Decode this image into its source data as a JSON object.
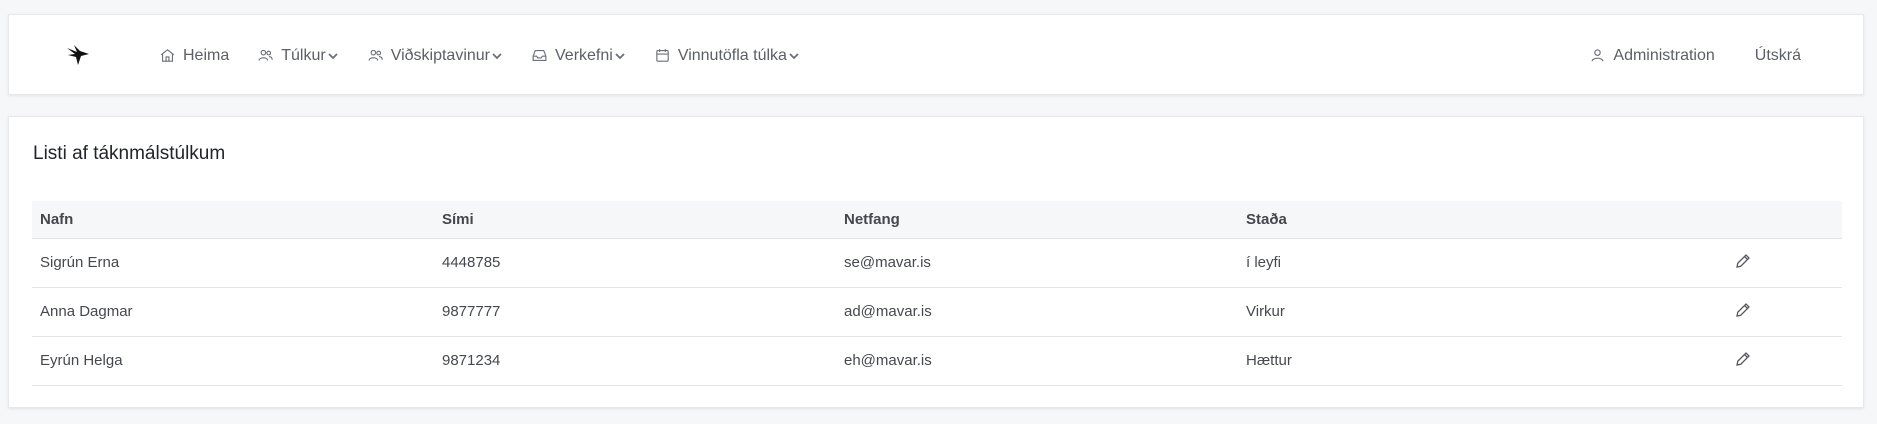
{
  "nav": {
    "logo_icon": "bird-logo-icon",
    "items": [
      {
        "label": "Heima",
        "icon": "home-icon",
        "dropdown": false
      },
      {
        "label": "Túlkur",
        "icon": "users-icon",
        "dropdown": true
      },
      {
        "label": "Viðskiptavinur",
        "icon": "users-icon",
        "dropdown": true
      },
      {
        "label": "Verkefni",
        "icon": "inbox-icon",
        "dropdown": true
      },
      {
        "label": "Vinnutöfla túlka",
        "icon": "calendar-icon",
        "dropdown": true
      }
    ],
    "admin_label": "Administration",
    "logout_label": "Útskrá"
  },
  "list": {
    "title": "Listi af táknmálstúlkum",
    "columns": [
      "Nafn",
      "Sími",
      "Netfang",
      "Staða"
    ],
    "rows": [
      {
        "name": "Sigrún Erna",
        "phone": "4448785",
        "email": "se@mavar.is",
        "status": "í leyfi"
      },
      {
        "name": "Anna Dagmar",
        "phone": "9877777",
        "email": "ad@mavar.is",
        "status": "Virkur"
      },
      {
        "name": "Eyrún Helga",
        "phone": "9871234",
        "email": "eh@mavar.is",
        "status": "Hættur"
      }
    ]
  }
}
